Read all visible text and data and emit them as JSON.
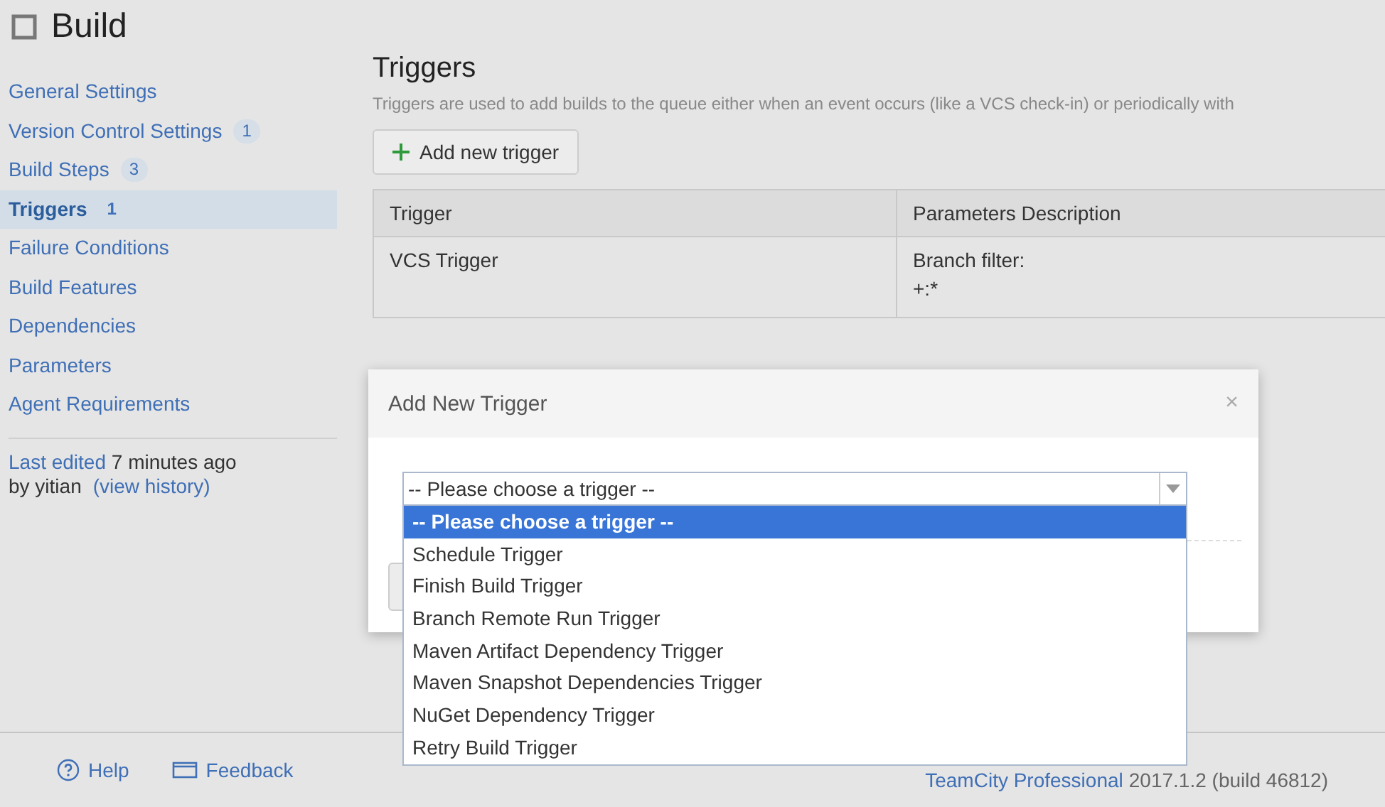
{
  "page": {
    "title": "Build"
  },
  "sidebar": {
    "items": [
      {
        "label": "General Settings",
        "selected": false
      },
      {
        "label": "Version Control Settings",
        "count": "1",
        "selected": false
      },
      {
        "label": "Build Steps",
        "count": "3",
        "selected": false
      },
      {
        "label": "Triggers",
        "count": "1",
        "selected": true
      },
      {
        "label": "Failure Conditions",
        "selected": false
      },
      {
        "label": "Build Features",
        "selected": false
      },
      {
        "label": "Dependencies",
        "selected": false
      },
      {
        "label": "Parameters",
        "selected": false
      },
      {
        "label": "Agent Requirements",
        "selected": false
      }
    ],
    "last_edited": {
      "label": "Last edited",
      "time": "7 minutes ago",
      "by": "by yitian",
      "link": "(view history)"
    }
  },
  "section": {
    "title": "Triggers",
    "description": "Triggers are used to add builds to the queue either when an event occurs (like a VCS check-in) or periodically with",
    "add_button": "Add new trigger"
  },
  "table": {
    "columns": [
      "Trigger",
      "Parameters Description"
    ],
    "rows": [
      {
        "trigger": "VCS Trigger",
        "description": [
          "Branch filter:",
          "+:*"
        ]
      }
    ]
  },
  "dialog": {
    "title": "Add New Trigger",
    "close": "×",
    "select": {
      "value": "-- Please choose a trigger --",
      "options": [
        {
          "label": "-- Please choose a trigger --",
          "selected": true
        },
        {
          "label": "Schedule Trigger",
          "selected": false
        },
        {
          "label": "Finish Build Trigger",
          "selected": false
        },
        {
          "label": "Branch Remote Run Trigger",
          "selected": false
        },
        {
          "label": "Maven Artifact Dependency Trigger",
          "selected": false
        },
        {
          "label": "Maven Snapshot Dependencies Trigger",
          "selected": false
        },
        {
          "label": "NuGet Dependency Trigger",
          "selected": false
        },
        {
          "label": "Retry Build Trigger",
          "selected": false
        }
      ]
    }
  },
  "footer": {
    "help": "Help",
    "feedback": "Feedback",
    "product": "TeamCity Professional",
    "version": "2017.1.2 (build 46812)"
  }
}
